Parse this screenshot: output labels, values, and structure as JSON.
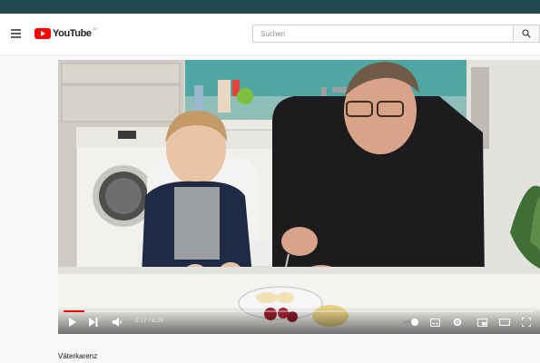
{
  "app": {
    "logo_text": "YouTube",
    "logo_region": "AT",
    "brand_color": "#ff0000"
  },
  "search": {
    "placeholder": "Suchen",
    "icon": "search-icon"
  },
  "player": {
    "time": "0:17 / 6:29",
    "progress": 0.044,
    "icons": [
      "play-icon",
      "next-icon",
      "volume-icon",
      "autoplay-toggle",
      "subtitles-icon",
      "settings-icon",
      "miniplayer-icon",
      "theater-icon",
      "fullscreen-icon"
    ]
  },
  "video": {
    "title": "Väterkarenz"
  }
}
